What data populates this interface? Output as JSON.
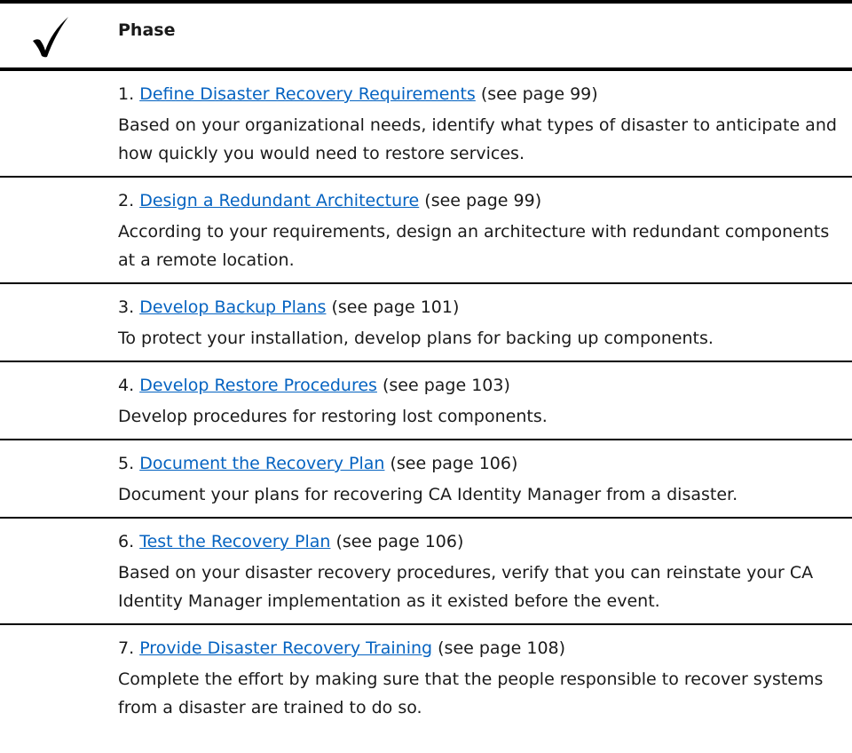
{
  "header": {
    "check_icon": "checkmark-icon",
    "label": "Phase"
  },
  "link_color": "#0563c1",
  "phases": [
    {
      "number": "1.",
      "link": "Define Disaster Recovery Requirements",
      "page_ref": "(see page 99)",
      "description": "Based on your organizational needs, identify what types of disaster to anticipate and how quickly you would need to restore services."
    },
    {
      "number": "2.",
      "link": "Design a Redundant Architecture",
      "page_ref": "(see page 99)",
      "description": "According to your requirements, design an architecture with redundant components at a remote location."
    },
    {
      "number": "3.",
      "link": "Develop Backup Plans",
      "page_ref": "(see page 101)",
      "description": "To protect your installation, develop plans for backing up components."
    },
    {
      "number": "4.",
      "link": "Develop Restore Procedures",
      "page_ref": "(see page 103)",
      "description": "Develop procedures for restoring lost components."
    },
    {
      "number": "5.",
      "link": "Document the Recovery Plan",
      "page_ref": "(see page 106)",
      "description": "Document your plans for recovering CA Identity Manager from a disaster."
    },
    {
      "number": "6.",
      "link": "Test the Recovery Plan",
      "page_ref": "(see page 106)",
      "description": "Based on your disaster recovery procedures, verify that you can reinstate your CA Identity Manager implementation as it existed before the event."
    },
    {
      "number": "7.",
      "link": "Provide Disaster Recovery Training",
      "page_ref": "(see page 108)",
      "description": "Complete the effort by making sure that the people responsible to recover systems from a disaster are trained to do so."
    }
  ]
}
